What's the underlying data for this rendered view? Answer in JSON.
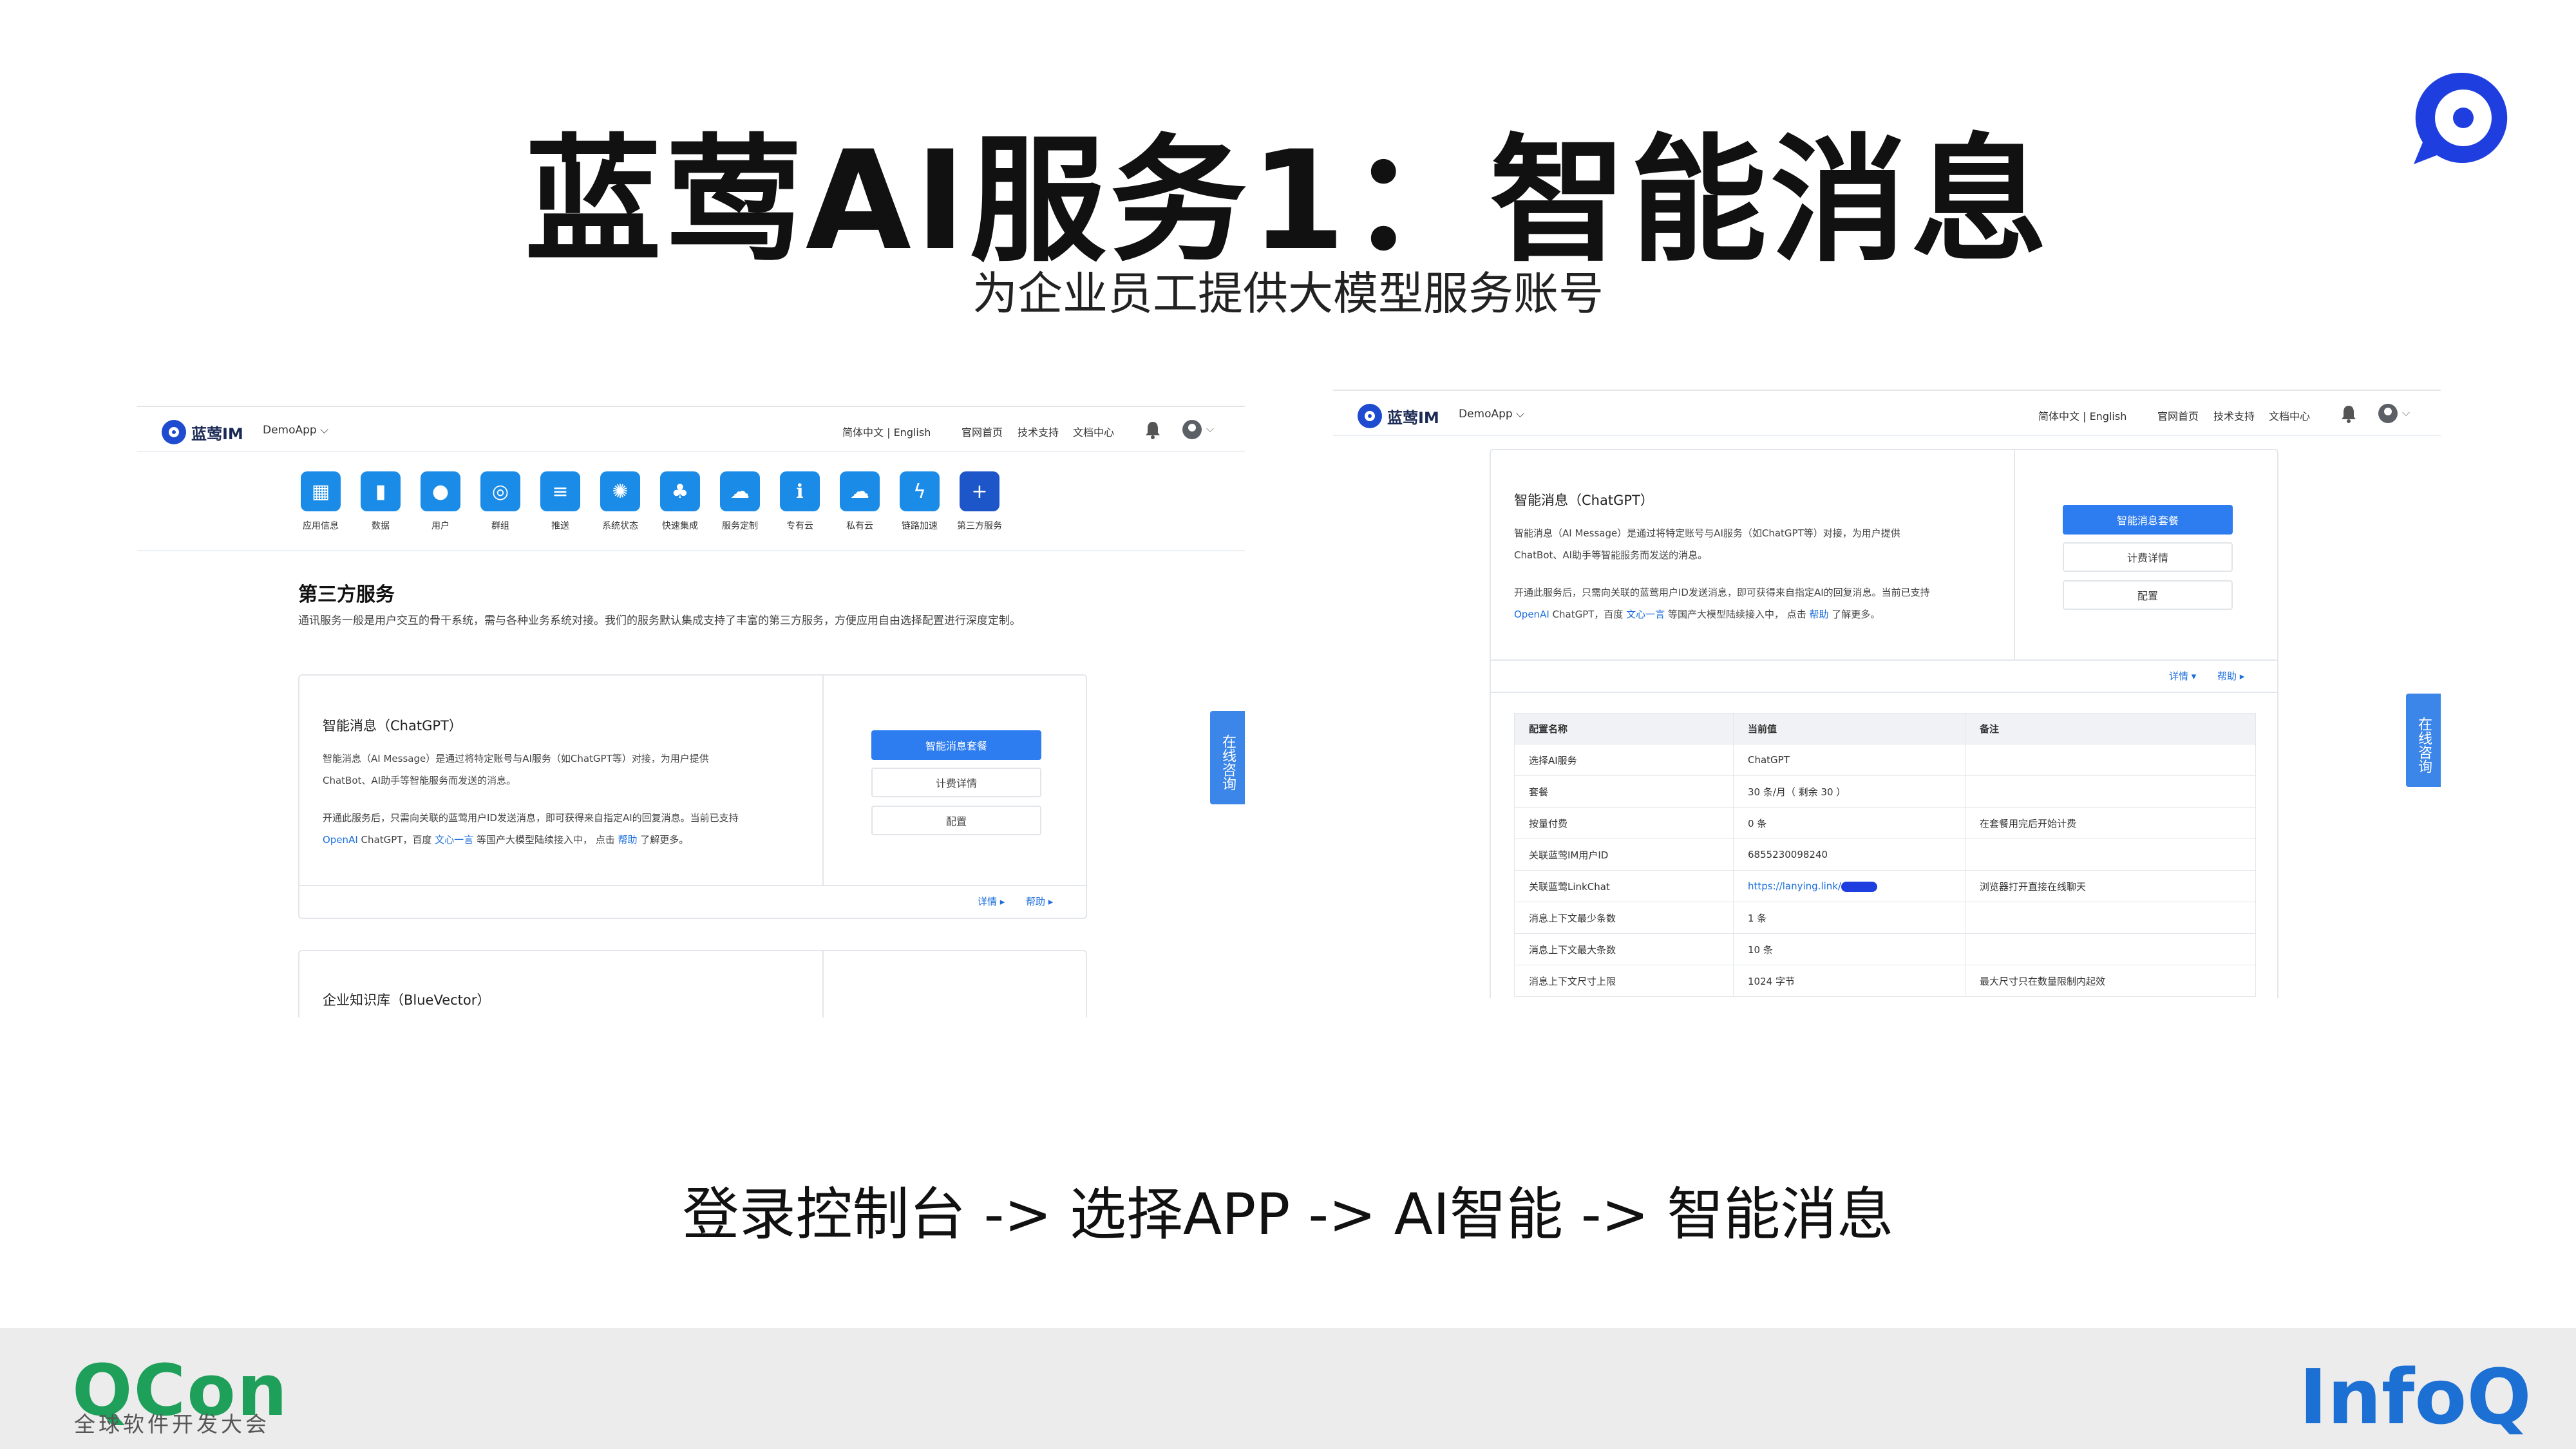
{
  "slide": {
    "title": "蓝莺AI服务1：智能消息",
    "subtitle": "为企业员工提供大模型服务账号",
    "flow": "登录控制台 -> 选择APP -> AI智能 -> 智能消息",
    "footer": {
      "left_logo": "QCon",
      "left_sub": "全球软件开发大会",
      "right_logo": "InfoQ"
    }
  },
  "console": {
    "brand": "蓝莺IM",
    "app_select": "DemoApp ⌵",
    "lang": "简体中文 | English",
    "links": [
      "官网首页",
      "技术支持",
      "文档中心"
    ],
    "avatar_caret": "⌵",
    "float_button": "在线咨询"
  },
  "left": {
    "nav": [
      {
        "label": "应用信息",
        "glyph": "▦"
      },
      {
        "label": "数据",
        "glyph": "▮"
      },
      {
        "label": "用户",
        "glyph": "●"
      },
      {
        "label": "群组",
        "glyph": "◎"
      },
      {
        "label": "推送",
        "glyph": "≡"
      },
      {
        "label": "系统状态",
        "glyph": "✺"
      },
      {
        "label": "快速集成",
        "glyph": "♣"
      },
      {
        "label": "服务定制",
        "glyph": "☁"
      },
      {
        "label": "专有云",
        "glyph": "ℹ"
      },
      {
        "label": "私有云",
        "glyph": "☁"
      },
      {
        "label": "链路加速",
        "glyph": "ϟ"
      },
      {
        "label": "第三方服务",
        "glyph": "+"
      }
    ],
    "heading": "第三方服务",
    "desc": "通讯服务一般是用户交互的骨干系统，需与各种业务系统对接。我们的服务默认集成支持了丰富的第三方服务，方便应用自由选择配置进行深度定制。",
    "card1": {
      "title": "智能消息（ChatGPT）",
      "p1a": "智能消息（AI Message）是通过将特定账号与AI服务（如ChatGPT等）对接，为用户提供",
      "p1b": "ChatBot、AI助手等智能服务而发送的消息。",
      "p2a": "开通此服务后，只需向关联的蓝莺用户ID发送消息，即可获得来自指定AI的回复消息。当前已支持",
      "p2b_l1": "OpenAI",
      "p2b_t1": " ChatGPT，百度 ",
      "p2b_l2": "文心一言",
      "p2b_t2": " 等国产大模型陆续接入中， 点击 ",
      "p2b_l3": "帮助",
      "p2b_t3": " 了解更多。",
      "btn_primary": "智能消息套餐",
      "btn_billing": "计费详情",
      "btn_config": "配置",
      "foot_detail": "详情 ▸",
      "foot_help": "帮助 ▸"
    },
    "card2": {
      "title": "企业知识库（BlueVector）"
    }
  },
  "right": {
    "card": {
      "title": "智能消息（ChatGPT）",
      "p1a": "智能消息（AI Message）是通过将特定账号与AI服务（如ChatGPT等）对接，为用户提供",
      "p1b": "ChatBot、AI助手等智能服务而发送的消息。",
      "p2a": "开通此服务后，只需向关联的蓝莺用户ID发送消息，即可获得来自指定AI的回复消息。当前已支持",
      "p2b_l1": "OpenAI",
      "p2b_t1": " ChatGPT，百度 ",
      "p2b_l2": "文心一言",
      "p2b_t2": " 等国产大模型陆续接入中， 点击 ",
      "p2b_l3": "帮助",
      "p2b_t3": " 了解更多。",
      "btn_primary": "智能消息套餐",
      "btn_billing": "计费详情",
      "btn_config": "配置",
      "foot_detail": "详情 ▾",
      "foot_help": "帮助 ▸"
    },
    "table": {
      "headers": [
        "配置名称",
        "当前值",
        "备注"
      ],
      "rows": [
        [
          "选择AI服务",
          "ChatGPT",
          ""
        ],
        [
          "套餐",
          "30 条/月（ 剩余 30 ）",
          ""
        ],
        [
          "按量付费",
          "0 条",
          "在套餐用完后开始计费"
        ],
        [
          "关联蓝莺IM用户ID",
          "6855230098240",
          ""
        ],
        [
          "关联蓝莺LinkChat",
          "https://lanying.link/",
          "浏览器打开直接在线聊天"
        ],
        [
          "消息上下文最少条数",
          "1 条",
          ""
        ],
        [
          "消息上下文最大条数",
          "10 条",
          ""
        ],
        [
          "消息上下文尺寸上限",
          "1024 字节",
          "最大尺寸只在数量限制内起效"
        ]
      ]
    }
  }
}
